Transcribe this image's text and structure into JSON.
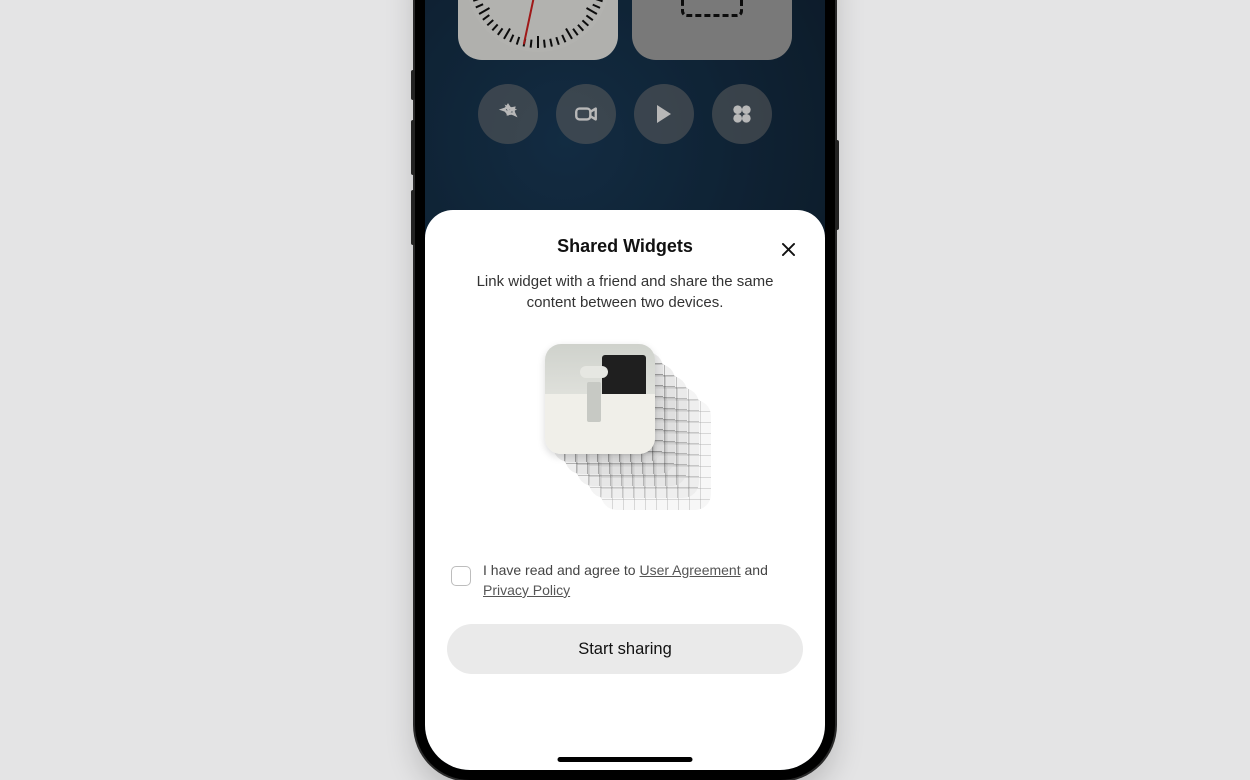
{
  "modal": {
    "title": "Shared Widgets",
    "subtitle": "Link widget with a friend and share the same content between two devices.",
    "consent_prefix": "I have read and agree to ",
    "consent_link1": "User Agreement",
    "consent_mid": " and ",
    "consent_link2": "Privacy Policy",
    "primary_button": "Start sharing"
  },
  "home": {
    "apps": [
      {
        "name": "photos-app-icon"
      },
      {
        "name": "camera-app-icon"
      },
      {
        "name": "play-store-icon"
      },
      {
        "name": "clover-app-icon"
      }
    ]
  }
}
